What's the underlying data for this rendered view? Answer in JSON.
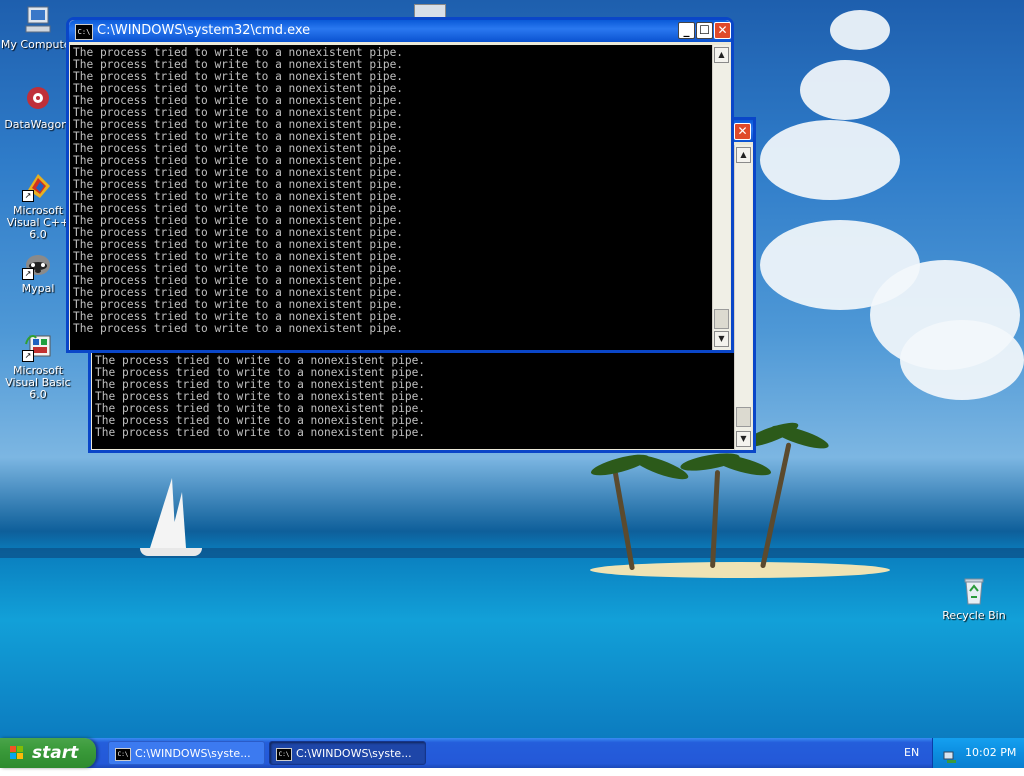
{
  "desktop": {
    "icons": [
      {
        "label": "My Computer"
      },
      {
        "label": "DataWagon."
      },
      {
        "label": "Microsoft Visual C++ 6.0"
      },
      {
        "label": "Mypal"
      },
      {
        "label": "Microsoft Visual Basic 6.0"
      }
    ],
    "recycle_bin": {
      "label": "Recycle Bin"
    }
  },
  "windows": {
    "front": {
      "title": "C:\\WINDOWS\\system32\\cmd.exe",
      "icon_text": "C:\\",
      "lines": [
        "The process tried to write to a nonexistent pipe.",
        "The process tried to write to a nonexistent pipe.",
        "The process tried to write to a nonexistent pipe.",
        "The process tried to write to a nonexistent pipe.",
        "The process tried to write to a nonexistent pipe.",
        "The process tried to write to a nonexistent pipe.",
        "The process tried to write to a nonexistent pipe.",
        "The process tried to write to a nonexistent pipe.",
        "The process tried to write to a nonexistent pipe.",
        "The process tried to write to a nonexistent pipe.",
        "The process tried to write to a nonexistent pipe.",
        "The process tried to write to a nonexistent pipe.",
        "The process tried to write to a nonexistent pipe.",
        "The process tried to write to a nonexistent pipe.",
        "The process tried to write to a nonexistent pipe.",
        "The process tried to write to a nonexistent pipe.",
        "The process tried to write to a nonexistent pipe.",
        "The process tried to write to a nonexistent pipe.",
        "The process tried to write to a nonexistent pipe.",
        "The process tried to write to a nonexistent pipe.",
        "The process tried to write to a nonexistent pipe.",
        "The process tried to write to a nonexistent pipe.",
        "The process tried to write to a nonexistent pipe.",
        "The process tried to write to a nonexistent pipe."
      ]
    },
    "back": {
      "lines": [
        "The process tried to write to a nonexistent pipe.",
        "The process tried to write to a nonexistent pipe.",
        "The process tried to write to a nonexistent pipe.",
        "The process tried to write to a nonexistent pipe.",
        "The process tried to write to a nonexistent pipe.",
        "The process tried to write to a nonexistent pipe.",
        "The process tried to write to a nonexistent pipe."
      ]
    }
  },
  "taskbar": {
    "start_label": "start",
    "tasks": [
      {
        "label": "C:\\WINDOWS\\syste...",
        "active": false
      },
      {
        "label": "C:\\WINDOWS\\syste...",
        "active": true
      }
    ],
    "language": "EN",
    "clock": "10:02 PM"
  },
  "colors": {
    "title_bar": "#0a5ad8",
    "console_bg": "#000000",
    "console_text": "#c0c0c0",
    "start_button": "#3a9a3a",
    "taskbar": "#245edb",
    "close_button": "#e04a2a"
  }
}
